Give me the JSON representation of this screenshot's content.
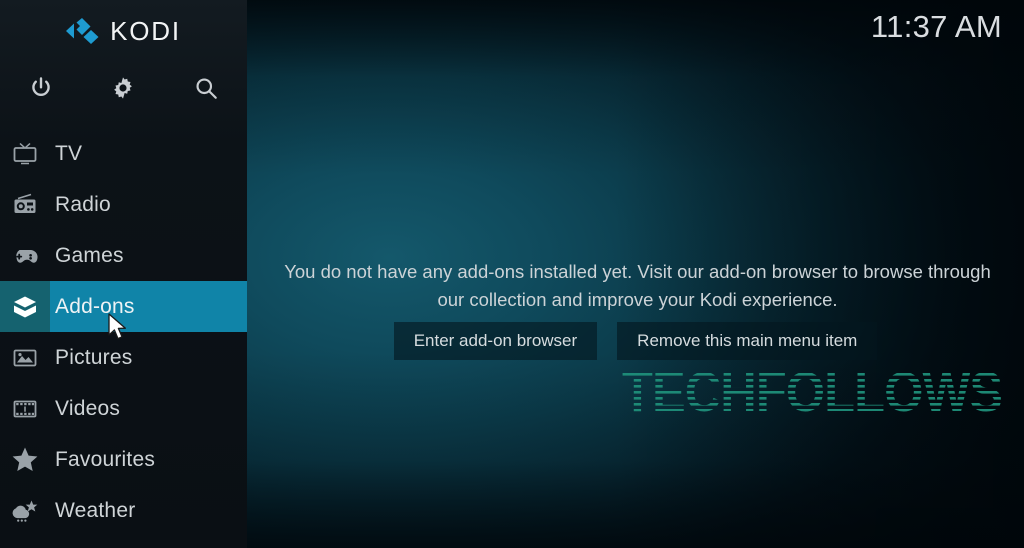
{
  "app": {
    "brand": "KODI",
    "logo_icon": "kodi-logo-icon",
    "accent_color": "#1084a8",
    "accent_dark_color": "#15626f",
    "sidebar_color": "#0c1217"
  },
  "header": {
    "clock": "11:37 AM"
  },
  "toolbar": {
    "items": [
      {
        "name": "power-icon",
        "label": "Power"
      },
      {
        "name": "gear-icon",
        "label": "Settings"
      },
      {
        "name": "search-icon",
        "label": "Search"
      }
    ]
  },
  "sidebar": {
    "items": [
      {
        "label": "TV",
        "icon": "tv-icon",
        "selected": false
      },
      {
        "label": "Radio",
        "icon": "radio-icon",
        "selected": false
      },
      {
        "label": "Games",
        "icon": "gamepad-icon",
        "selected": false
      },
      {
        "label": "Add-ons",
        "icon": "addons-box-icon",
        "selected": true
      },
      {
        "label": "Pictures",
        "icon": "pictures-icon",
        "selected": false
      },
      {
        "label": "Videos",
        "icon": "film-strip-icon",
        "selected": false
      },
      {
        "label": "Favourites",
        "icon": "star-icon",
        "selected": false
      },
      {
        "label": "Weather",
        "icon": "weather-icon",
        "selected": false
      }
    ]
  },
  "main": {
    "message": "You do not have any add-ons installed yet. Visit our add-on browser to browse through our collection and improve your Kodi experience.",
    "buttons": [
      {
        "label": "Enter add-on browser"
      },
      {
        "label": "Remove this main menu item"
      }
    ]
  },
  "watermark": {
    "text": "TECHFOLLOWS",
    "color": "#1f8f7a"
  },
  "cursor": {
    "icon": "mouse-pointer-icon"
  }
}
